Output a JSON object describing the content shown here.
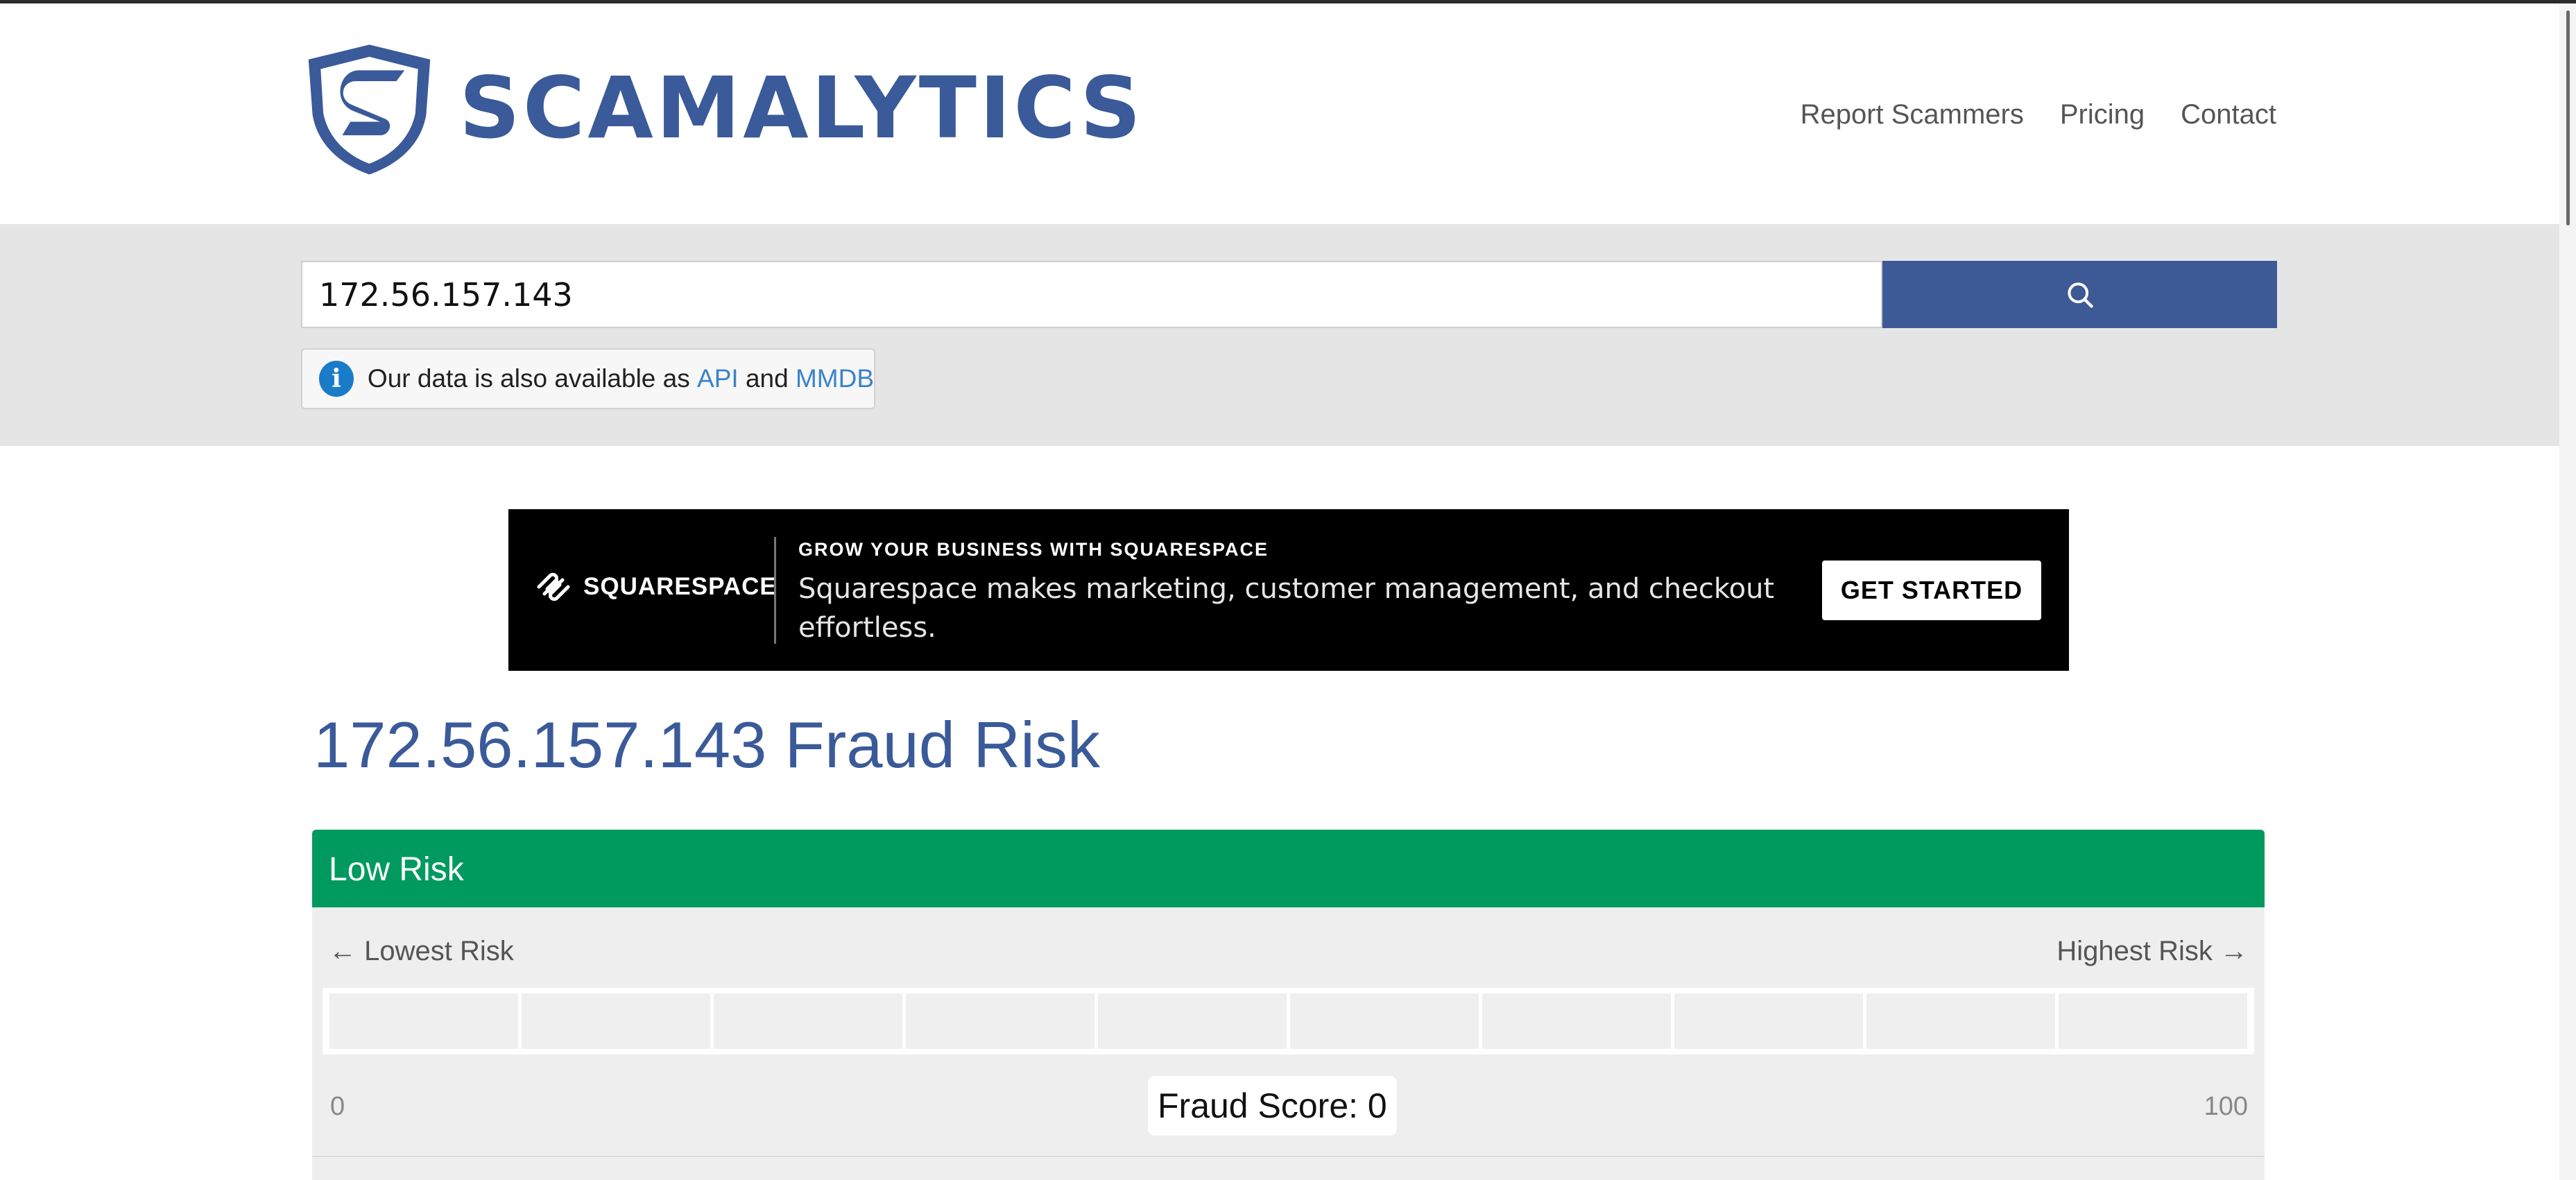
{
  "header": {
    "logo_text": "SCAMALYTICS",
    "nav": [
      "Report Scammers",
      "Pricing",
      "Contact"
    ]
  },
  "search": {
    "value": "172.56.157.143",
    "button_icon": "search-icon"
  },
  "info": {
    "icon": "info-icon",
    "text_before": "Our data is also available as",
    "link_api": "API",
    "text_and": "and",
    "link_mmdb": "MMDB"
  },
  "ad": {
    "brand": "SQUARESPACE",
    "eyebrow": "GROW YOUR BUSINESS WITH SQUARESPACE",
    "body": "Squarespace makes marketing, customer management, and checkout effortless.",
    "cta": "GET STARTED"
  },
  "result": {
    "title": "172.56.157.143 Fraud Risk",
    "risk_level": "Low Risk",
    "scale_low": "← Lowest Risk",
    "scale_high": "Highest Risk →",
    "score_min": "0",
    "score_max": "100",
    "score_label": "Fraud Score: 0",
    "score_value": 0
  },
  "colors": {
    "brand_blue": "#3a5a99",
    "search_button": "#3d5a96",
    "low_risk_green": "#009a5f",
    "link_blue": "#3a83c9"
  }
}
